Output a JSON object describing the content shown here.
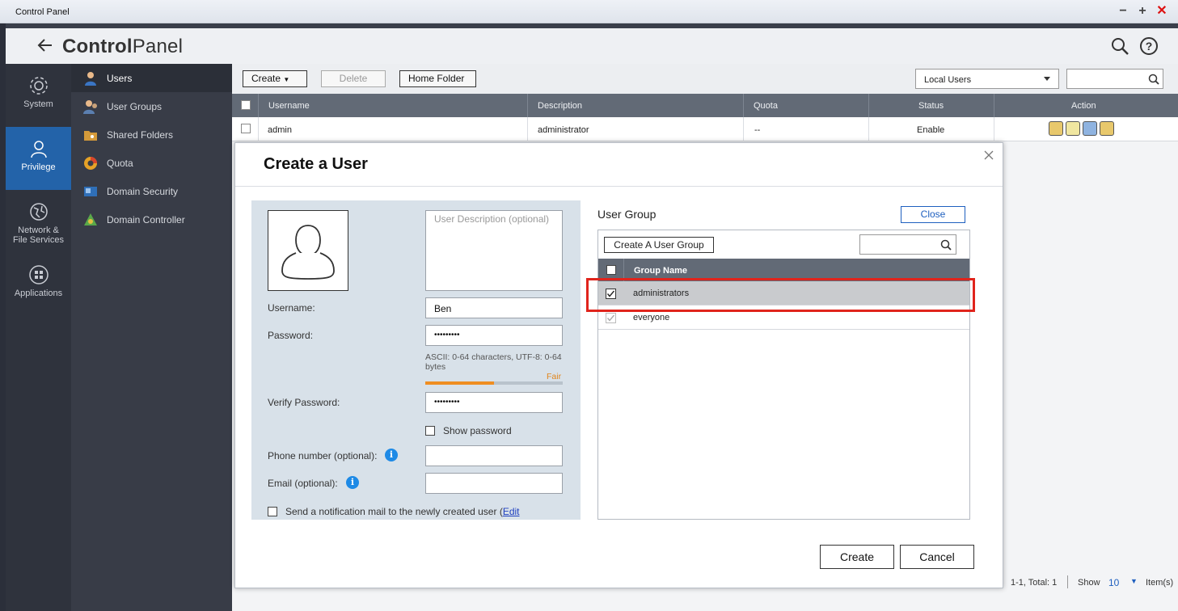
{
  "window": {
    "title": "Control Panel"
  },
  "header": {
    "title_bold": "Control",
    "title_light": "Panel"
  },
  "rail": [
    {
      "label": "System",
      "icon": "gear-icon"
    },
    {
      "label": "Privilege",
      "icon": "user-icon"
    },
    {
      "label": "Network &",
      "label2": "File Services",
      "icon": "globe-icon"
    },
    {
      "label": "Applications",
      "icon": "grid-icon"
    }
  ],
  "subnav": [
    {
      "label": "Users",
      "icon": "user-icon"
    },
    {
      "label": "User Groups",
      "icon": "user-group-icon"
    },
    {
      "label": "Shared Folders",
      "icon": "shared-folder-icon"
    },
    {
      "label": "Quota",
      "icon": "pie-icon"
    },
    {
      "label": "Domain Security",
      "icon": "domain-security-icon"
    },
    {
      "label": "Domain Controller",
      "icon": "domain-controller-icon"
    }
  ],
  "toolbar": {
    "create": "Create",
    "delete": "Delete",
    "home_folder": "Home Folder",
    "filter_value": "Local Users"
  },
  "table": {
    "columns": [
      "Username",
      "Description",
      "Quota",
      "Status",
      "Action"
    ],
    "rows": [
      {
        "username": "admin",
        "description": "administrator",
        "quota": "--",
        "status": "Enable"
      }
    ]
  },
  "pager": {
    "range": "1-1, Total: 1",
    "show": "Show",
    "count": "10",
    "items": "Item(s)"
  },
  "modal": {
    "title": "Create a User",
    "description_placeholder": "User Description (optional)",
    "username_label": "Username:",
    "username_value": "Ben",
    "password_label": "Password:",
    "password_value": "•••••••••",
    "password_hint": "ASCII: 0-64 characters, UTF-8: 0-64 bytes",
    "strength_label": "Fair",
    "strength_fraction": 0.5,
    "verify_label": "Verify Password:",
    "verify_value": "•••••••••",
    "show_password": "Show password",
    "phone_label": "Phone number (optional):",
    "email_label": "Email (optional):",
    "notify_text": "Send a notification mail to the newly created user (",
    "notify_link": "Edit",
    "user_group_title": "User Group",
    "close_label": "Close",
    "create_group_label": "Create A User Group",
    "group_name_header": "Group Name",
    "groups": [
      {
        "name": "administrators",
        "checked": true
      },
      {
        "name": "everyone",
        "checked": true
      }
    ],
    "create_label": "Create",
    "cancel_label": "Cancel"
  },
  "colors": {
    "accent": "#2363a9",
    "highlight": "#e0241c",
    "strength": "#ef8e22"
  }
}
